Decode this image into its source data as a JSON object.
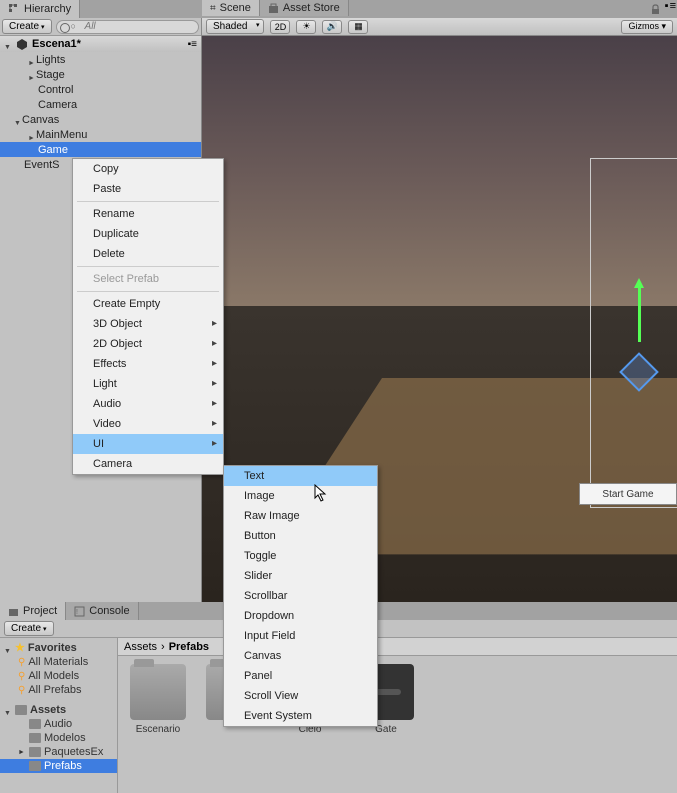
{
  "tabs": {
    "hierarchy": "Hierarchy",
    "scene": "Scene",
    "asset_store": "Asset Store",
    "project": "Project",
    "console": "Console"
  },
  "hierarchy": {
    "create": "Create",
    "search_placeholder": "All",
    "scene_name": "Escena1*",
    "items": [
      {
        "label": "Lights",
        "indent": 1,
        "arrow": "right"
      },
      {
        "label": "Stage",
        "indent": 1,
        "arrow": "right"
      },
      {
        "label": "Control",
        "indent": 1,
        "arrow": "none"
      },
      {
        "label": "Camera",
        "indent": 1,
        "arrow": "none"
      },
      {
        "label": "Canvas",
        "indent": 0,
        "arrow": "down"
      },
      {
        "label": "MainMenu",
        "indent": 1,
        "arrow": "right"
      },
      {
        "label": "Game",
        "indent": 1,
        "arrow": "none",
        "selected": true
      },
      {
        "label": "EventSystem",
        "indent": 0,
        "arrow": "none",
        "sub": "EventS"
      }
    ]
  },
  "scene_toolbar": {
    "shaded": "Shaded",
    "twod": "2D"
  },
  "scene": {
    "start_game_btn": "Start Game"
  },
  "context_menu": {
    "items": [
      {
        "label": "Copy"
      },
      {
        "label": "Paste"
      },
      {
        "sep": true
      },
      {
        "label": "Rename"
      },
      {
        "label": "Duplicate"
      },
      {
        "label": "Delete"
      },
      {
        "sep": true
      },
      {
        "label": "Select Prefab",
        "disabled": true
      },
      {
        "sep": true
      },
      {
        "label": "Create Empty"
      },
      {
        "label": "3D Object",
        "sub": true
      },
      {
        "label": "2D Object",
        "sub": true
      },
      {
        "label": "Effects",
        "sub": true
      },
      {
        "label": "Light",
        "sub": true
      },
      {
        "label": "Audio",
        "sub": true
      },
      {
        "label": "Video",
        "sub": true
      },
      {
        "label": "UI",
        "sub": true,
        "highlighted": true
      },
      {
        "label": "Camera"
      }
    ]
  },
  "submenu": {
    "items": [
      {
        "label": "Text",
        "highlighted": true
      },
      {
        "label": "Image"
      },
      {
        "label": "Raw Image"
      },
      {
        "label": "Button"
      },
      {
        "label": "Toggle"
      },
      {
        "label": "Slider"
      },
      {
        "label": "Scrollbar"
      },
      {
        "label": "Dropdown"
      },
      {
        "label": "Input Field"
      },
      {
        "label": "Canvas"
      },
      {
        "label": "Panel"
      },
      {
        "label": "Scroll View"
      },
      {
        "label": "Event System"
      }
    ]
  },
  "project": {
    "create": "Create",
    "favorites": "Favorites",
    "fav_items": [
      "All Materials",
      "All Models",
      "All Prefabs"
    ],
    "assets_root": "Assets",
    "asset_folders": [
      "Audio",
      "Modelos",
      "PaquetesEx",
      "Prefabs"
    ],
    "breadcrumb": [
      "Assets",
      "Prefabs"
    ],
    "grid_items": [
      {
        "label": "Escenario",
        "type": "folder"
      },
      {
        "label": "",
        "type": "folder"
      },
      {
        "label": "Cielo",
        "type": "img1"
      },
      {
        "label": "Gate",
        "type": "img2"
      }
    ]
  }
}
